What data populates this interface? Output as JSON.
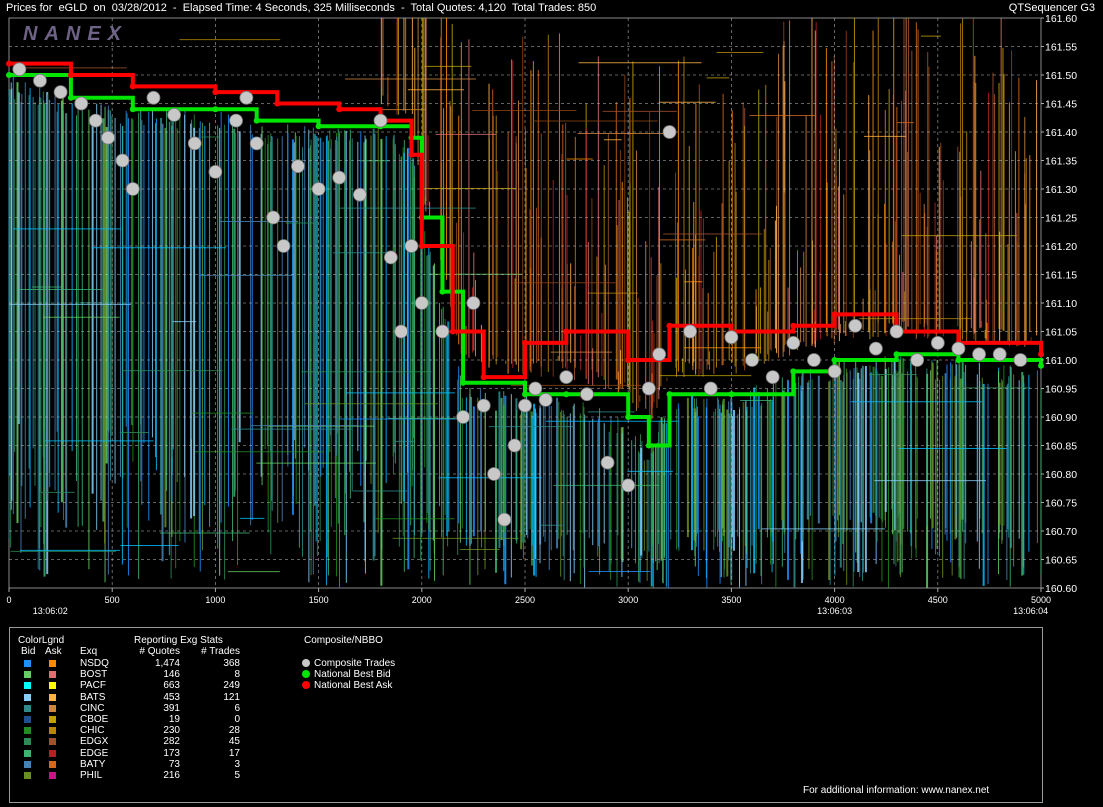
{
  "header": {
    "title": "Prices for  eGLD  on  03/28/2012  -  Elapsed Time: 4 Seconds, 325 Milliseconds  -  Total Quotes: 4,120  Total Trades: 850",
    "app_name": "QTSequencer G3"
  },
  "watermark": "NANEX",
  "chart_data": {
    "type": "line",
    "title": "Prices for  eGLD  on  03/28/2012",
    "xlim": [
      0,
      5000
    ],
    "ylim": [
      160.6,
      161.6
    ],
    "x_ticks": [
      0,
      500,
      1000,
      1500,
      2000,
      2500,
      3000,
      3500,
      4000,
      4500,
      5000
    ],
    "y_ticks": [
      160.6,
      160.65,
      160.7,
      160.75,
      160.8,
      160.85,
      160.9,
      160.95,
      161.0,
      161.05,
      161.1,
      161.15,
      161.2,
      161.25,
      161.3,
      161.35,
      161.4,
      161.45,
      161.5,
      161.55,
      161.6
    ],
    "time_labels": [
      {
        "x": 200,
        "label": "13:06:02"
      },
      {
        "x": 4000,
        "label": "13:06:03"
      },
      {
        "x": 4950,
        "label": "13:06:04"
      }
    ],
    "grid": true,
    "series": [
      {
        "name": "Composite Trades",
        "color": "#c8c8c8",
        "points": [
          [
            50,
            161.51
          ],
          [
            150,
            161.49
          ],
          [
            250,
            161.47
          ],
          [
            350,
            161.45
          ],
          [
            420,
            161.42
          ],
          [
            480,
            161.39
          ],
          [
            550,
            161.35
          ],
          [
            600,
            161.3
          ],
          [
            700,
            161.46
          ],
          [
            800,
            161.43
          ],
          [
            900,
            161.38
          ],
          [
            1000,
            161.33
          ],
          [
            1100,
            161.42
          ],
          [
            1150,
            161.46
          ],
          [
            1200,
            161.38
          ],
          [
            1280,
            161.25
          ],
          [
            1330,
            161.2
          ],
          [
            1400,
            161.34
          ],
          [
            1500,
            161.3
          ],
          [
            1600,
            161.32
          ],
          [
            1700,
            161.29
          ],
          [
            1800,
            161.42
          ],
          [
            1850,
            161.18
          ],
          [
            1900,
            161.05
          ],
          [
            1950,
            161.2
          ],
          [
            2000,
            161.1
          ],
          [
            2100,
            161.05
          ],
          [
            2200,
            160.9
          ],
          [
            2250,
            161.1
          ],
          [
            2300,
            160.92
          ],
          [
            2350,
            160.8
          ],
          [
            2400,
            160.72
          ],
          [
            2450,
            160.85
          ],
          [
            2500,
            160.92
          ],
          [
            2550,
            160.95
          ],
          [
            2600,
            160.93
          ],
          [
            2700,
            160.97
          ],
          [
            2800,
            160.94
          ],
          [
            2900,
            160.82
          ],
          [
            3000,
            160.78
          ],
          [
            3100,
            160.95
          ],
          [
            3150,
            161.01
          ],
          [
            3200,
            161.4
          ],
          [
            3300,
            161.05
          ],
          [
            3400,
            160.95
          ],
          [
            3500,
            161.04
          ],
          [
            3600,
            161.0
          ],
          [
            3700,
            160.97
          ],
          [
            3800,
            161.03
          ],
          [
            3900,
            161.0
          ],
          [
            4000,
            160.98
          ],
          [
            4100,
            161.06
          ],
          [
            4200,
            161.02
          ],
          [
            4300,
            161.05
          ],
          [
            4400,
            161.0
          ],
          [
            4500,
            161.03
          ],
          [
            4600,
            161.02
          ],
          [
            4700,
            161.01
          ],
          [
            4800,
            161.01
          ],
          [
            4900,
            161.0
          ]
        ]
      },
      {
        "name": "National Best Bid",
        "color": "#00e600",
        "points": [
          [
            0,
            161.5
          ],
          [
            300,
            161.46
          ],
          [
            600,
            161.44
          ],
          [
            1000,
            161.44
          ],
          [
            1200,
            161.42
          ],
          [
            1500,
            161.41
          ],
          [
            1800,
            161.41
          ],
          [
            1950,
            161.39
          ],
          [
            2000,
            161.25
          ],
          [
            2100,
            161.12
          ],
          [
            2200,
            160.96
          ],
          [
            2500,
            160.94
          ],
          [
            2700,
            160.94
          ],
          [
            3000,
            160.9
          ],
          [
            3100,
            160.85
          ],
          [
            3200,
            160.94
          ],
          [
            3500,
            160.94
          ],
          [
            3800,
            160.98
          ],
          [
            4000,
            161.0
          ],
          [
            4300,
            161.01
          ],
          [
            4600,
            161.0
          ],
          [
            5000,
            160.99
          ]
        ]
      },
      {
        "name": "National Best Ask",
        "color": "#ff0000",
        "points": [
          [
            0,
            161.52
          ],
          [
            300,
            161.5
          ],
          [
            600,
            161.48
          ],
          [
            1000,
            161.47
          ],
          [
            1300,
            161.45
          ],
          [
            1600,
            161.44
          ],
          [
            1800,
            161.42
          ],
          [
            1950,
            161.36
          ],
          [
            2000,
            161.2
          ],
          [
            2150,
            161.05
          ],
          [
            2300,
            160.97
          ],
          [
            2500,
            161.03
          ],
          [
            2700,
            161.05
          ],
          [
            3000,
            161.0
          ],
          [
            3200,
            161.06
          ],
          [
            3500,
            161.05
          ],
          [
            3800,
            161.06
          ],
          [
            4000,
            161.08
          ],
          [
            4300,
            161.05
          ],
          [
            4600,
            161.03
          ],
          [
            5000,
            161.01
          ]
        ]
      }
    ]
  },
  "legend": {
    "colorlegend_title": "ColorLgnd",
    "col_bid": "Bid",
    "col_ask": "Ask",
    "col_exq": "Exq",
    "stats_title": "Reporting Exg Stats",
    "col_quotes": "# Quotes",
    "col_trades": "# Trades",
    "exchanges": [
      {
        "name": "NSDQ",
        "quotes": "1,474",
        "trades": "368",
        "bid_color": "#1e90ff",
        "ask_color": "#ff8c00"
      },
      {
        "name": "BOST",
        "quotes": "146",
        "trades": "8",
        "bid_color": "#66cc66",
        "ask_color": "#e07070"
      },
      {
        "name": "PACF",
        "quotes": "663",
        "trades": "249",
        "bid_color": "#00ffff",
        "ask_color": "#ffff00"
      },
      {
        "name": "BATS",
        "quotes": "453",
        "trades": "121",
        "bid_color": "#87cefa",
        "ask_color": "#ffb347"
      },
      {
        "name": "CINC",
        "quotes": "391",
        "trades": "6",
        "bid_color": "#2e8b8b",
        "ask_color": "#cd853f"
      },
      {
        "name": "CBOE",
        "quotes": "19",
        "trades": "0",
        "bid_color": "#1f4f8f",
        "ask_color": "#c0a000"
      },
      {
        "name": "CHIC",
        "quotes": "230",
        "trades": "28",
        "bid_color": "#228b22",
        "ask_color": "#b8860b"
      },
      {
        "name": "EDGX",
        "quotes": "282",
        "trades": "45",
        "bid_color": "#2e8b57",
        "ask_color": "#a0522d"
      },
      {
        "name": "EDGE",
        "quotes": "173",
        "trades": "17",
        "bid_color": "#3cb371",
        "ask_color": "#b22222"
      },
      {
        "name": "BATY",
        "quotes": "73",
        "trades": "3",
        "bid_color": "#4682b4",
        "ask_color": "#d2691e"
      },
      {
        "name": "PHIL",
        "quotes": "216",
        "trades": "5",
        "bid_color": "#6b8e23",
        "ask_color": "#c71585"
      }
    ],
    "composite_title": "Composite/NBBO",
    "composite_items": [
      {
        "label": "Composite Trades",
        "color": "#c8c8c8"
      },
      {
        "label": "National Best Bid",
        "color": "#00e600"
      },
      {
        "label": "National Best Ask",
        "color": "#ff0000"
      }
    ],
    "footer_info": "For additional information: www.nanex.net"
  }
}
